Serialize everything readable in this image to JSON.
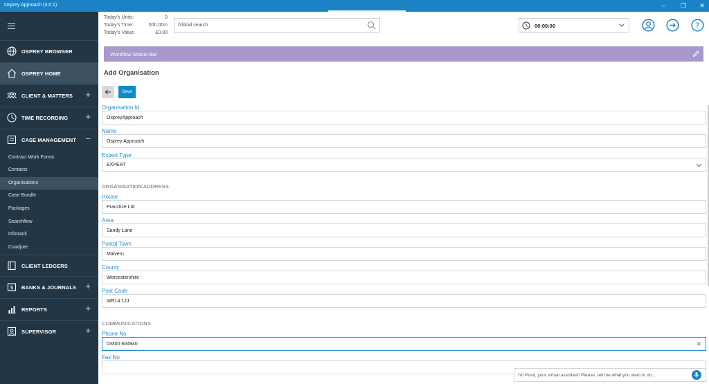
{
  "window": {
    "title": "Osprey Approach (3.0.1)"
  },
  "sidebar": {
    "nav": [
      {
        "label": "OSPREY BROWSER",
        "icon": "globe-icon",
        "toggle": ""
      },
      {
        "label": "OSPREY HOME",
        "icon": "home-icon",
        "toggle": ""
      },
      {
        "label": "CLIENT & MATTERS",
        "icon": "people-icon",
        "toggle": "+"
      },
      {
        "label": "TIME RECORDING",
        "icon": "clock-icon",
        "toggle": "+"
      },
      {
        "label": "CASE MANAGEMENT",
        "icon": "folder-icon",
        "toggle": "−"
      },
      {
        "label": "CLIENT LEDGERS",
        "icon": "ledger-icon",
        "toggle": ""
      },
      {
        "label": "BANKS & JOURNALS",
        "icon": "bank-icon",
        "toggle": "+"
      },
      {
        "label": "REPORTS",
        "icon": "chart-icon",
        "toggle": "+"
      },
      {
        "label": "SUPERVISOR",
        "icon": "supervisor-icon",
        "toggle": "+"
      }
    ],
    "case_management_items": [
      "Contract Work Forms",
      "Contacts",
      "Organisations",
      "Case Bundle",
      "Packages",
      "Searchflow",
      "Infotrack",
      "Coadjute"
    ]
  },
  "header": {
    "stats": [
      {
        "label": "Today's Units:",
        "value": "0"
      },
      {
        "label": "Today's Time:",
        "value": "00h:00m"
      },
      {
        "label": "Today's Value:",
        "value": "£0.00"
      }
    ],
    "search_placeholder": "Global search",
    "timer_value": "00:00:00"
  },
  "content": {
    "workflow_status": "Workflow Status Bar",
    "page_title": "Add Organisation",
    "save_label": "Save",
    "fields": {
      "organisation_id": {
        "label": "Organisation Id",
        "value": "OspreyApproach"
      },
      "name": {
        "label": "Name",
        "value": "Osprey Approach"
      },
      "expert_type": {
        "label": "Expert Type",
        "value": "EXPERT"
      },
      "house": {
        "label": "House",
        "value": "Pracctice Ltd"
      },
      "area": {
        "label": "Area",
        "value": "Sandy Lane"
      },
      "postal_town": {
        "label": "Postal Town",
        "value": "Malvern"
      },
      "county": {
        "label": "County",
        "value": "Worcestershire"
      },
      "post_code": {
        "label": "Post Code",
        "value": "WR14 1JJ"
      },
      "phone_no": {
        "label": "Phone No",
        "value": "03300 604940"
      },
      "fax_no": {
        "label": "Fax No",
        "value": ""
      }
    },
    "sections": {
      "address": "ORGANISATION ADDRESS",
      "communications": "COMMUNICATIONS"
    }
  },
  "assistant": {
    "placeholder": "I'm Posit, your virtual assistant! Please, tell me what you want to do..."
  },
  "colors": {
    "accent": "#1b82c6",
    "sidebar": "#233645",
    "workflow_bar": "#a898cc",
    "label": "#1d8ccc"
  }
}
